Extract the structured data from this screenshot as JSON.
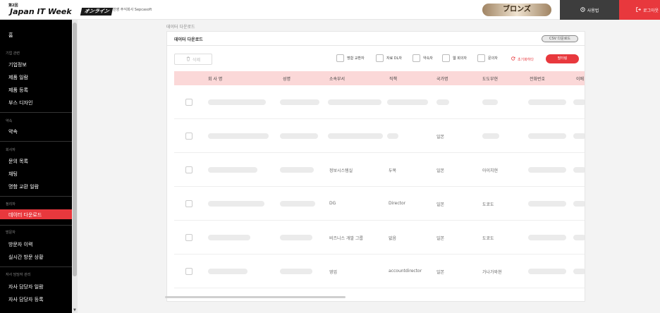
{
  "header": {
    "logo_edition": "第2回",
    "logo_name": "Japan IT Week",
    "logo_online": "オンライン",
    "company": "한영 주식회사 Sepcasoft",
    "rank_badge": "ブロンズ",
    "manual_label": "사용법",
    "logout_label": "로그아웃"
  },
  "sidebar": {
    "home": "홈",
    "sections": {
      "company": "기업 관련",
      "reservation": "약속",
      "activity": "회사자",
      "data": "정리자",
      "visitors": "방문자",
      "staff": "자사 담당자 관리"
    },
    "items": {
      "company_info": "기업정보",
      "product_list": "제품 일람",
      "product_register": "제품 등록",
      "booth_design": "부스 디자인",
      "appointments": "약속",
      "inquiry_list": "문의 목록",
      "chat": "채팅",
      "card_exchange": "명함 교환 일람",
      "data_download": "데이터 다운로드",
      "visitor_history": "방문자 이력",
      "realtime_visits": "실시간 방문 상황",
      "staff_list": "자사 담당자 일람",
      "staff_register": "자사 담당자 등록"
    }
  },
  "breadcrumb": "데이터 다운로드",
  "panel": {
    "title": "데이터 다운로드",
    "csv_button": "CSV 다운로드",
    "delete_button": "삭제",
    "filters": [
      "명함 교환자",
      "자료 DL자",
      "약속자",
      "웹 회의자",
      "문의자"
    ],
    "reset_label": "초기화하다",
    "search_button": "필터링"
  },
  "table": {
    "headers": [
      "회 사 명",
      "성명",
      "소속부서",
      "직책",
      "국가명",
      "도도부현",
      "전화번호",
      "이메"
    ],
    "rows": [
      [
        "",
        "",
        "",
        "",
        "",
        "",
        "",
        ""
      ],
      [
        "",
        "",
        "",
        "",
        "일본",
        "",
        "",
        ""
      ],
      [
        "",
        "",
        "정보시스템실",
        "두목",
        "일본",
        "아이치현",
        "",
        ""
      ],
      [
        "",
        "",
        "DG",
        "Director",
        "일본",
        "도쿄도",
        "",
        ""
      ],
      [
        "",
        "",
        "비즈니스 개발 그룹",
        "없음",
        "일본",
        "도쿄도",
        "",
        ""
      ],
      [
        "",
        "",
        "영업",
        "accountdirector",
        "일본",
        "가나가와현",
        "",
        ""
      ]
    ]
  },
  "colors": {
    "accent": "#e8383d",
    "sidebar_bg": "#000000",
    "table_header_bg": "#fbd8d8",
    "badge_bronze": "#a08463"
  },
  "icons": {
    "manual": "clock-icon",
    "logout": "logout-icon",
    "delete": "trash-icon",
    "reset": "reset-icon",
    "scroll_down": "chevron-down-icon"
  }
}
